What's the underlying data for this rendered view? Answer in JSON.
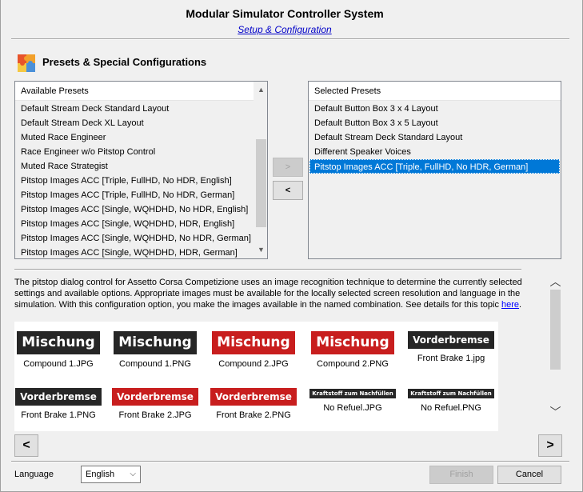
{
  "window": {
    "title": "Modular Simulator Controller System",
    "subtitle_link": "Setup & Configuration"
  },
  "section": {
    "title": "Presets & Special Configurations",
    "icon": "puzzle-icon"
  },
  "available_presets": {
    "header": "Available Presets",
    "items": [
      "Default Stream Deck Standard Layout",
      "Default Stream Deck XL Layout",
      "Muted Race Engineer",
      "Race Engineer w/o Pitstop Control",
      "Muted Race Strategist",
      "Pitstop Images ACC [Triple, FullHD, No HDR, English]",
      "Pitstop Images ACC [Triple, FullHD, No HDR, German]",
      "Pitstop Images ACC [Single, WQHDHD, No HDR, English]",
      "Pitstop Images ACC [Single, WQHDHD, HDR, English]",
      "Pitstop Images ACC [Single, WQHDHD, No HDR, German]",
      "Pitstop Images ACC [Single, WQHDHD, HDR, German]"
    ]
  },
  "selected_presets": {
    "header": "Selected Presets",
    "items": [
      "Default Button Box 3 x 4 Layout",
      "Default Button Box 3 x 5 Layout",
      "Default Stream Deck Standard Layout",
      "Different Speaker Voices",
      "Pitstop Images ACC [Triple, FullHD, No HDR, German]"
    ],
    "selected_index": 4
  },
  "transfer": {
    "add_label": ">",
    "remove_label": "<"
  },
  "description": {
    "text": "The pitstop dialog control for Assetto Corsa Competizione uses an image recognition technique to determine the currently selected settings and available options. Appropriate images must be available for the locally selected screen resolution and language in the simulation. With this configuration option, you make the images available in the named combination. See details for this topic ",
    "link": "here",
    "trailing": "."
  },
  "gallery": {
    "images": [
      {
        "badge": "Mischung",
        "caption": "Compound 1.JPG"
      },
      {
        "badge": "Mischung",
        "caption": "Compound 1.PNG"
      },
      {
        "badge": "Mischung",
        "caption": "Compound 2.JPG"
      },
      {
        "badge": "Mischung",
        "caption": "Compound 2.PNG"
      },
      {
        "badge": "Vorderbremse",
        "caption": "Front Brake 1.jpg"
      },
      {
        "badge": "Vorderbremse",
        "caption": "Front Brake 1.PNG"
      },
      {
        "badge": "Vorderbremse",
        "caption": "Front Brake 2.JPG"
      },
      {
        "badge": "Vorderbremse",
        "caption": "Front Brake 2.PNG"
      },
      {
        "badge": "Kraftstoff zum Nachfüllen",
        "caption": "No Refuel.JPG"
      },
      {
        "badge": "Kraftstoff zum Nachfüllen",
        "caption": "No Refuel.PNG"
      }
    ]
  },
  "nav": {
    "prev_label": "<",
    "next_label": ">"
  },
  "footer": {
    "language_label": "Language",
    "language_value": "English",
    "finish_label": "Finish",
    "cancel_label": "Cancel"
  },
  "colors": {
    "selection": "#0078d7",
    "link": "#0000c8",
    "badge_dark": "#262626",
    "badge_red": "#c81e1e"
  }
}
